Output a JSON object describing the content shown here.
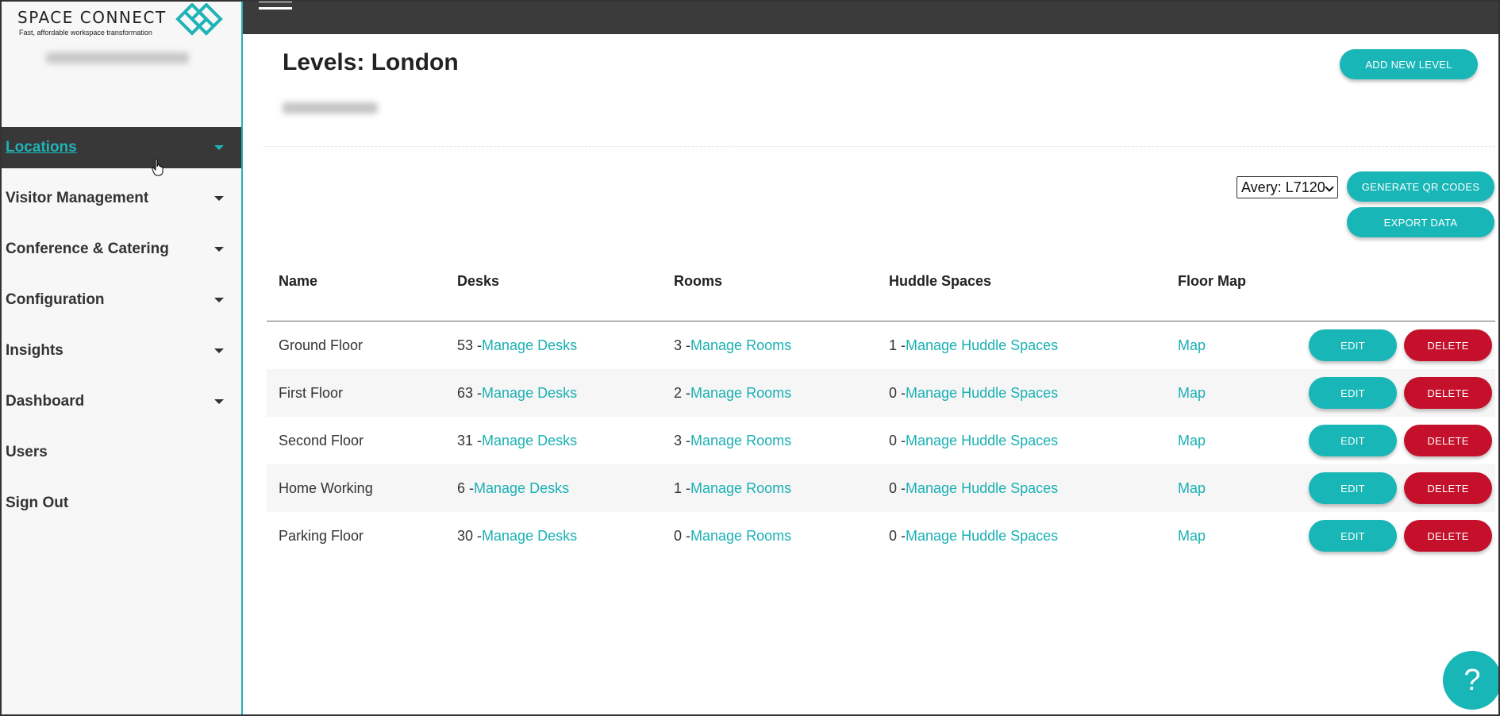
{
  "brand": {
    "name": "SPACE CONNECT",
    "tagline": "Fast, affordable workspace transformation"
  },
  "colors": {
    "accent": "#1fb3b6",
    "danger": "#c5102b",
    "topbar": "#3b3b3b",
    "nav_active": "#383838"
  },
  "sidebar": {
    "items": [
      {
        "label": "Locations",
        "active": true,
        "has_caret": true
      },
      {
        "label": "Visitor Management",
        "has_caret": true
      },
      {
        "label": "Conference & Catering",
        "has_caret": true
      },
      {
        "label": "Configuration",
        "has_caret": true
      },
      {
        "label": "Insights",
        "has_caret": true
      },
      {
        "label": "Dashboard",
        "has_caret": true
      },
      {
        "label": "Users",
        "has_caret": false
      },
      {
        "label": "Sign Out",
        "has_caret": false
      }
    ]
  },
  "main": {
    "title": "Levels: London",
    "add_button": "ADD NEW LEVEL",
    "label_select": {
      "value": "Avery: L7120"
    },
    "generate_button": "GENERATE QR CODES",
    "export_button": "EXPORT DATA",
    "table": {
      "headers": [
        "Name",
        "Desks",
        "Rooms",
        "Huddle Spaces",
        "Floor Map"
      ],
      "rows": [
        {
          "name": "Ground Floor",
          "desks": "53 - ",
          "desks_link": "Manage Desks",
          "rooms": "3 - ",
          "rooms_link": "Manage Rooms",
          "huddle": "1 - ",
          "huddle_link": "Manage Huddle Spaces",
          "map": "Map",
          "edit": "EDIT",
          "delete": "DELETE"
        },
        {
          "name": "First Floor",
          "desks": "63 - ",
          "desks_link": "Manage Desks",
          "rooms": "2 - ",
          "rooms_link": "Manage Rooms",
          "huddle": "0 - ",
          "huddle_link": "Manage Huddle Spaces",
          "map": "Map",
          "edit": "EDIT",
          "delete": "DELETE"
        },
        {
          "name": "Second Floor",
          "desks": "31 - ",
          "desks_link": "Manage Desks",
          "rooms": "3 - ",
          "rooms_link": "Manage Rooms",
          "huddle": "0 - ",
          "huddle_link": "Manage Huddle Spaces",
          "map": "Map",
          "edit": "EDIT",
          "delete": "DELETE"
        },
        {
          "name": "Home Working",
          "desks": "6 - ",
          "desks_link": "Manage Desks",
          "rooms": "1 - ",
          "rooms_link": "Manage Rooms",
          "huddle": "0 - ",
          "huddle_link": "Manage Huddle Spaces",
          "map": "Map",
          "edit": "EDIT",
          "delete": "DELETE"
        },
        {
          "name": "Parking Floor",
          "desks": "30 - ",
          "desks_link": "Manage Desks",
          "rooms": "0 - ",
          "rooms_link": "Manage Rooms",
          "huddle": "0 - ",
          "huddle_link": "Manage Huddle Spaces",
          "map": "Map",
          "edit": "EDIT",
          "delete": "DELETE"
        }
      ]
    }
  },
  "help": {
    "label": "?"
  }
}
